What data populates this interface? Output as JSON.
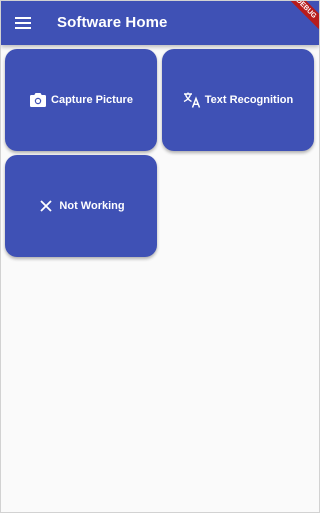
{
  "appbar": {
    "title": "Software Home",
    "menu_icon": "hamburger-menu-icon",
    "debug_banner": "DEBUG",
    "color": "#3f51b5"
  },
  "cards": [
    {
      "label": "Capture Picture",
      "icon": "camera-icon"
    },
    {
      "label": "Text Recognition",
      "icon": "translate-icon"
    },
    {
      "label": "Not Working",
      "icon": "close-icon"
    }
  ],
  "colors": {
    "primary": "#3f51b5",
    "background": "#fafafa",
    "on_primary": "#ffffff"
  }
}
